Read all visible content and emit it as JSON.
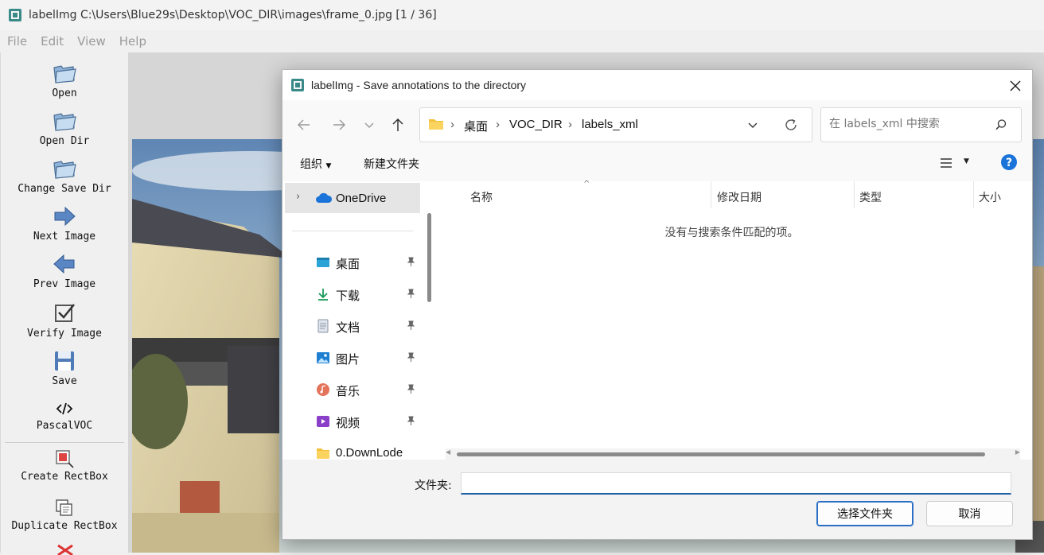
{
  "main_window": {
    "title": "labelImg C:\\Users\\Blue29s\\Desktop\\VOC_DIR\\images\\frame_0.jpg [1 / 36]",
    "menu": [
      "File",
      "Edit",
      "View",
      "Help"
    ]
  },
  "toolbar": {
    "open": "Open",
    "open_dir": "Open Dir",
    "change_save_dir": "Change Save Dir",
    "next_image": "Next Image",
    "prev_image": "Prev Image",
    "verify_image": "Verify Image",
    "save": "Save",
    "format": "PascalVOC",
    "create_rectbox": "Create RectBox",
    "duplicate_rectbox": "Duplicate RectBox"
  },
  "dialog": {
    "title": "labelImg - Save annotations to the directory",
    "breadcrumb": [
      "桌面",
      "VOC_DIR",
      "labels_xml"
    ],
    "search_placeholder": "在 labels_xml 中搜索",
    "commands": {
      "organize": "组织",
      "new_folder": "新建文件夹"
    },
    "nav": {
      "onedrive": "OneDrive",
      "items": [
        "桌面",
        "下载",
        "文档",
        "图片",
        "音乐",
        "视频",
        "0.DownLode"
      ]
    },
    "columns": [
      "名称",
      "修改日期",
      "类型",
      "大小"
    ],
    "empty_message": "没有与搜索条件匹配的项。",
    "folder_label": "文件夹:",
    "folder_value": "",
    "select_button": "选择文件夹",
    "cancel_button": "取消"
  },
  "colors": {
    "accent": "#2a6fc4",
    "folder_yellow": "#f3c03b",
    "onedrive_blue": "#1a73d9"
  }
}
